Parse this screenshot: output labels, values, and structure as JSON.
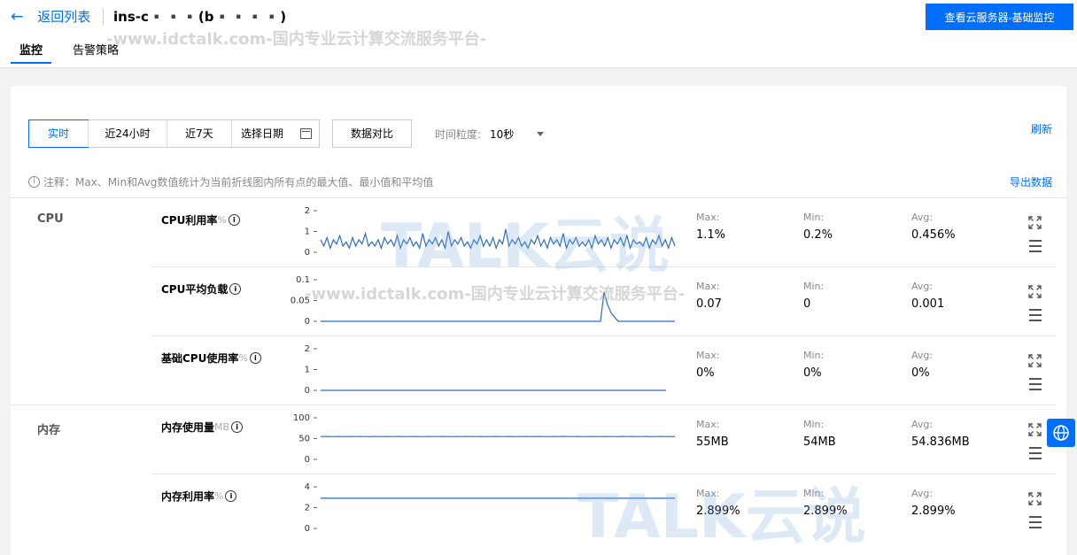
{
  "header": {
    "back_label": "返回列表",
    "instance_title": "ins-c▪️▪️▪️(b▪️▪️▪️▪️)",
    "view_button": "查看云服务器-基础监控"
  },
  "tabs": [
    {
      "label": "监控"
    },
    {
      "label": "告警策略"
    }
  ],
  "toolbar": {
    "ranges": [
      "实时",
      "近24小时",
      "近7天"
    ],
    "date_picker": "选择日期",
    "compare_button": "数据对比",
    "granularity_label": "时间粒度:",
    "granularity_value": "10秒",
    "refresh": "刷新"
  },
  "note": {
    "text": "注释：Max、Min和Avg数值统计为当前折线图内所有点的最大值、最小值和平均值",
    "export": "导出数据"
  },
  "watermark": {
    "url_text": "-www.idctalk.com-国内专业云计算交流服务平台-",
    "brand": "TALK云说"
  },
  "groups": [
    {
      "label": "CPU"
    },
    {
      "label": "内存"
    }
  ],
  "metrics": [
    {
      "name": "CPU利用率",
      "unit": "%",
      "max_label": "Max:",
      "max": "1.1%",
      "min_label": "Min:",
      "min": "0.2%",
      "avg_label": "Avg:",
      "avg": "0.456%",
      "chart_data": {
        "type": "line",
        "yticks": [
          "2",
          "1",
          "0"
        ],
        "ylim": [
          0,
          2
        ],
        "series": [
          {
            "values": [
              0.6,
              0.3,
              0.7,
              0.2,
              0.6,
              0.4,
              0.8,
              0.3,
              0.5,
              0.2,
              0.7,
              0.3,
              0.6,
              0.4,
              0.9,
              0.3,
              0.5,
              0.3,
              0.6,
              0.2,
              0.7,
              0.4,
              0.6,
              0.3,
              0.8,
              0.2,
              0.6,
              0.4,
              0.7,
              0.3,
              0.5,
              0.2,
              0.9,
              0.3,
              0.6,
              0.4,
              0.7,
              0.3,
              0.6,
              0.2,
              1.0,
              0.3,
              0.6,
              0.4,
              0.7,
              0.3,
              0.5,
              0.2,
              0.6,
              0.4,
              0.8,
              0.3,
              0.6,
              0.3,
              0.7,
              0.2,
              0.6,
              0.4,
              1.1,
              0.3,
              0.6,
              0.4,
              0.7,
              0.3,
              0.5,
              0.2,
              0.6,
              0.4,
              0.8,
              0.3,
              0.6,
              0.2,
              0.7,
              0.4,
              0.6,
              0.3,
              0.9,
              0.2,
              0.6,
              0.4,
              0.7,
              0.3,
              0.5,
              0.3,
              0.6,
              0.2,
              0.8,
              0.4,
              0.6,
              0.3,
              0.7,
              0.2,
              0.6,
              0.4,
              0.7,
              0.3,
              0.8,
              0.2,
              0.6,
              0.4,
              0.5,
              0.3,
              0.7,
              0.2,
              0.6,
              0.4,
              0.8,
              0.3,
              0.6,
              0.2,
              0.7,
              0.3
            ]
          }
        ]
      }
    },
    {
      "name": "CPU平均负载",
      "unit": "",
      "max_label": "Max:",
      "max": "0.07",
      "min_label": "Min:",
      "min": "0",
      "avg_label": "Avg:",
      "avg": "0.001",
      "chart_data": {
        "type": "line",
        "yticks": [
          "0.1",
          "0.05",
          "0"
        ],
        "ylim": [
          0,
          0.1
        ],
        "series": [
          {
            "values": [
              0,
              0,
              0,
              0,
              0,
              0,
              0,
              0,
              0,
              0,
              0,
              0,
              0,
              0,
              0,
              0,
              0,
              0,
              0,
              0,
              0,
              0,
              0,
              0,
              0,
              0,
              0,
              0,
              0,
              0,
              0,
              0,
              0,
              0,
              0,
              0,
              0,
              0,
              0,
              0,
              0,
              0,
              0,
              0,
              0,
              0,
              0,
              0,
              0,
              0,
              0,
              0,
              0,
              0,
              0,
              0,
              0,
              0,
              0,
              0,
              0,
              0,
              0,
              0,
              0,
              0,
              0,
              0,
              0,
              0,
              0,
              0,
              0,
              0,
              0,
              0,
              0,
              0,
              0,
              0,
              0.07,
              0.04,
              0.02,
              0.01,
              0,
              0,
              0,
              0,
              0,
              0,
              0,
              0,
              0,
              0,
              0,
              0,
              0,
              0,
              0,
              0,
              0
            ]
          }
        ]
      }
    },
    {
      "name": "基础CPU使用率",
      "unit": "%",
      "max_label": "Max:",
      "max": "0%",
      "min_label": "Min:",
      "min": "0%",
      "avg_label": "Avg:",
      "avg": "0%",
      "chart_data": {
        "type": "line",
        "yticks": [
          "2",
          "1",
          "0"
        ],
        "ylim": [
          0,
          2
        ],
        "series": [
          {
            "values": [
              0,
              0,
              0,
              0,
              0,
              0,
              0,
              0,
              0,
              0,
              0,
              0,
              0,
              0,
              0,
              0,
              0,
              0,
              0,
              0,
              0,
              0,
              0,
              0,
              0,
              0,
              0,
              0,
              0,
              0,
              0,
              0,
              0,
              0,
              0,
              0,
              0,
              0,
              0,
              0,
              0,
              0,
              0,
              0,
              0,
              0,
              0,
              0,
              0,
              0,
              0,
              0,
              0,
              0,
              0,
              0,
              0,
              0,
              0,
              0,
              0,
              0,
              0,
              0,
              0,
              0,
              0,
              0,
              0,
              0,
              0,
              0,
              0,
              0,
              0,
              0,
              0,
              0,
              0,
              0,
              0,
              0,
              0,
              0,
              0,
              0,
              0,
              0,
              0,
              0,
              0,
              0,
              0,
              0,
              0,
              0,
              0,
              0,
              0
            ]
          }
        ]
      }
    },
    {
      "name": "内存使用量",
      "unit": "MB",
      "max_label": "Max:",
      "max": "55MB",
      "min_label": "Min:",
      "min": "54MB",
      "avg_label": "Avg:",
      "avg": "54.836MB",
      "chart_data": {
        "type": "line",
        "yticks": [
          "100",
          "50",
          "0"
        ],
        "ylim": [
          0,
          100
        ],
        "series": [
          {
            "values": [
              55,
              54.8,
              55,
              54.9,
              54.8,
              55,
              54.9,
              54.7,
              55,
              54.8,
              54.9,
              55,
              54.8,
              54.9,
              54.7,
              55,
              54.8,
              54.9,
              55,
              54.8,
              54.9,
              54.8,
              55,
              54.7,
              54.9,
              54.8,
              55,
              54.8,
              54.9,
              54.7,
              55,
              54.8,
              54.9,
              54.8,
              55,
              54.9,
              54.8,
              54.7,
              55,
              54.8,
              54.9,
              55,
              54.8,
              54.9,
              54.8,
              55,
              54.7,
              54.9,
              54.8,
              55,
              54.8,
              54.9,
              54.8,
              55,
              54.7,
              54.9,
              54.8,
              55,
              54.8,
              54.9,
              54.8,
              55,
              54.9,
              54.8,
              54.7,
              55,
              54.8,
              54.9,
              55,
              54.8,
              54.9,
              54.8,
              55,
              54.7,
              54.9,
              54.8,
              55,
              54.8,
              54.9,
              54.8,
              55,
              54.9,
              54.8,
              54.7,
              55,
              54.8,
              54.9,
              55,
              54.8,
              54.9,
              54.8,
              55,
              54.7,
              54.9,
              54.8,
              55,
              54.8,
              54.9,
              54.8,
              55
            ]
          }
        ]
      }
    },
    {
      "name": "内存利用率",
      "unit": "%",
      "max_label": "Max:",
      "max": "2.899%",
      "min_label": "Min:",
      "min": "2.899%",
      "avg_label": "Avg:",
      "avg": "2.899%",
      "chart_data": {
        "type": "line",
        "yticks": [
          "4",
          "2",
          "0"
        ],
        "ylim": [
          0,
          4
        ],
        "series": [
          {
            "values": [
              2.899,
              2.899,
              2.899,
              2.899,
              2.899,
              2.899,
              2.899,
              2.899,
              2.899,
              2.899,
              2.899,
              2.899,
              2.899,
              2.899,
              2.899,
              2.899,
              2.899,
              2.899,
              2.899,
              2.899
            ]
          }
        ]
      }
    }
  ]
}
